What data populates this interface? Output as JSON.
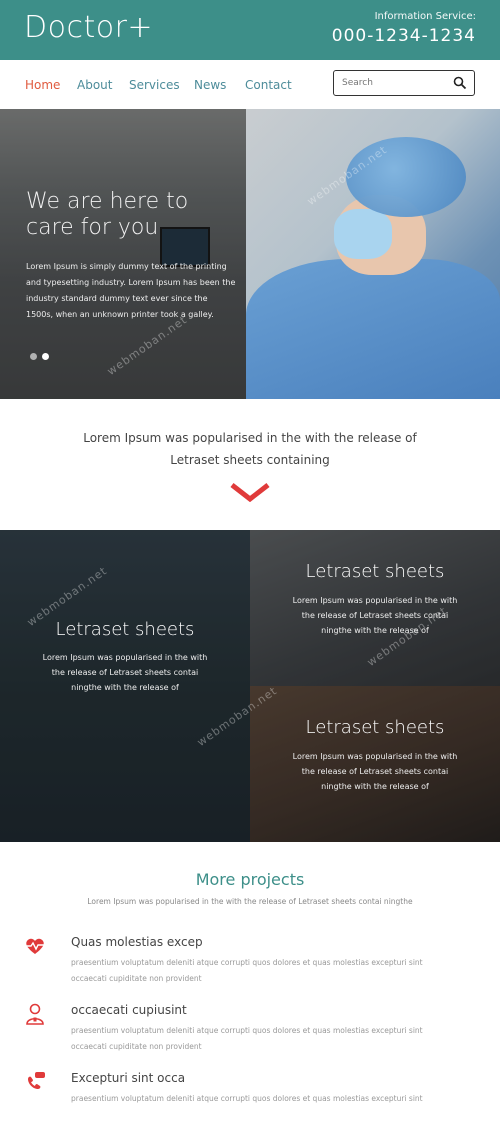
{
  "header": {
    "logo": "Doctor+",
    "info_label": "Information Service:",
    "phone": "000-1234-1234"
  },
  "nav": {
    "items": [
      {
        "label": "Home",
        "active": true
      },
      {
        "label": "About"
      },
      {
        "label": "Services"
      },
      {
        "label": "News"
      },
      {
        "label": "Contact"
      }
    ]
  },
  "search": {
    "placeholder": "Search"
  },
  "hero": {
    "title": "We are here to care for you",
    "text": "Lorem Ipsum is simply dummy text of the printing and typesetting industry. Lorem Ipsum has been the industry standard dummy text ever since the 1500s, when an unknown printer took a galley.",
    "slides": 2,
    "active_slide": 1
  },
  "intro": {
    "line1": "Lorem Ipsum was popularised in the with the release of",
    "line2": "Letraset sheets containing"
  },
  "tiles": [
    {
      "title": "Letraset sheets",
      "text": "Lorem Ipsum was popularised in the with the release of Letraset sheets contai ningthe with the release of"
    },
    {
      "title": "Letraset sheets",
      "text": "Lorem Ipsum was popularised in the with the release of Letraset sheets contai ningthe with the release of"
    },
    {
      "title": "Letraset sheets",
      "text": "Lorem Ipsum was popularised in the with the release of Letraset sheets contai ningthe with the release of"
    }
  ],
  "projects": {
    "title": "More projects",
    "subtitle": "Lorem Ipsum was popularised in the with the release of Letraset sheets contai ningthe",
    "items": [
      {
        "title": "Quas molestias excep",
        "text": "praesentium voluptatum deleniti atque corrupti quos dolores et quas molestias excepturi sint occaecati cupiditate non provident",
        "icon": "heart-pulse-icon"
      },
      {
        "title": "occaecati cupiusint",
        "text": "praesentium voluptatum deleniti atque corrupti quos dolores et quas molestias excepturi sint occaecati cupiditate non provident",
        "icon": "doctor-icon"
      },
      {
        "title": "Excepturi sint occa",
        "text": "praesentium voluptatum deleniti atque corrupti quos dolores et quas molestias excepturi sint",
        "icon": "phone-chat-icon"
      }
    ]
  },
  "colors": {
    "brand": "#3d8f89",
    "accent": "#e03a3a",
    "nav_active": "#e05b3f"
  }
}
